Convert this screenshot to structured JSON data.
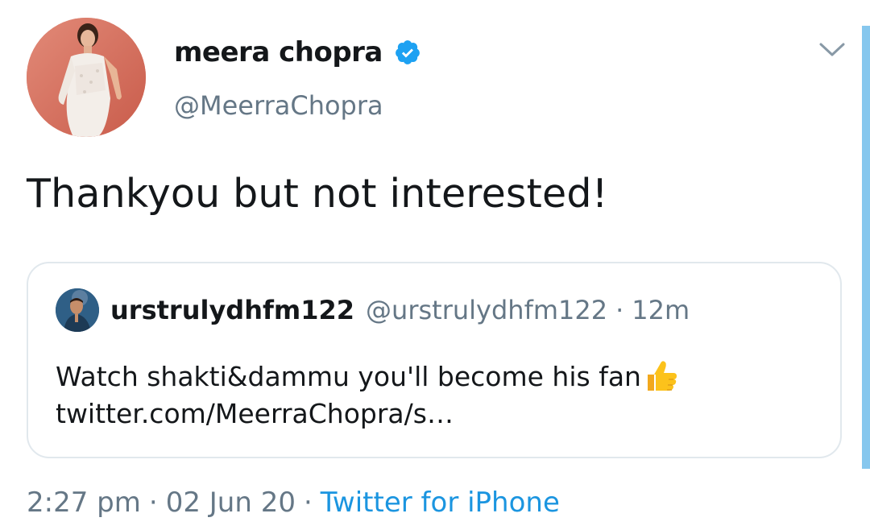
{
  "tweet": {
    "author": {
      "display_name": "meera chopra",
      "handle": "@MeerraChopra",
      "avatar_icon": "profile-photo-woman-white-dress",
      "verified_icon": "verified-badge-icon"
    },
    "text": "Thankyou but not interested!",
    "quoted": {
      "display_name": "urstrulydhfm122",
      "handle": "@urstrulydhfm122",
      "separator": "·",
      "time": "12m",
      "body_line1": "Watch shakti&dammu you'll become his fan",
      "body_emoji": "thumbs-up-icon",
      "body_line2": "twitter.com/MeerraChopra/s…"
    },
    "meta": {
      "time": "2:27 pm",
      "separator1": "·",
      "date": "02 Jun 20",
      "separator2": "·",
      "source": "Twitter for iPhone"
    }
  },
  "colors": {
    "text_primary": "#14171a",
    "text_secondary": "#657786",
    "link": "#1b95e0",
    "verified": "#1da1f2",
    "border": "#e1e8ed"
  }
}
